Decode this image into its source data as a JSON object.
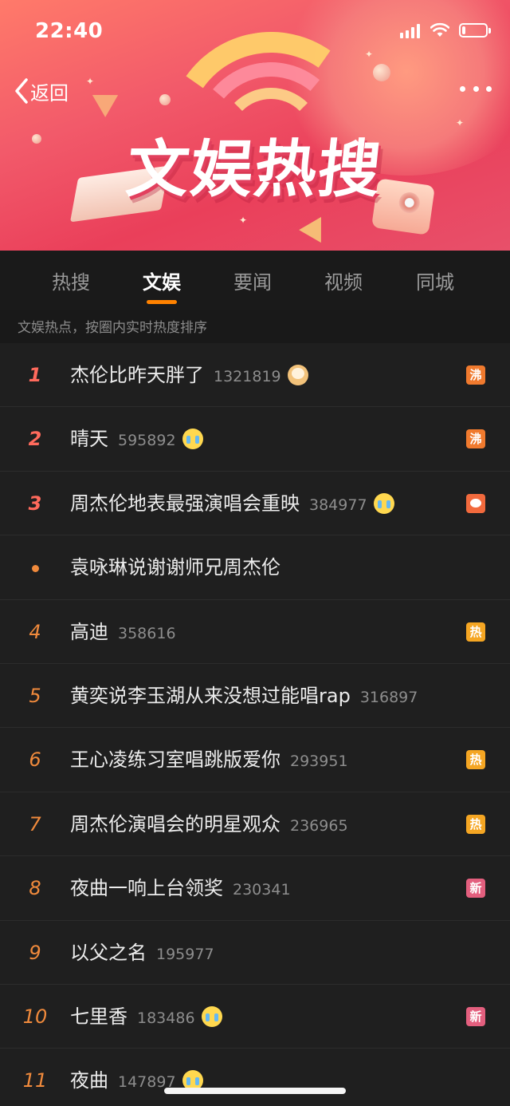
{
  "status_bar": {
    "time": "22:40",
    "battery_level": 0.15
  },
  "header": {
    "back_label": "返回",
    "title": "文娱热搜"
  },
  "tabs": [
    {
      "label": "热搜",
      "active": false
    },
    {
      "label": "文娱",
      "active": true
    },
    {
      "label": "要闻",
      "active": false
    },
    {
      "label": "视频",
      "active": false
    },
    {
      "label": "同城",
      "active": false
    }
  ],
  "subheading": "文娱热点，按圈内实时热度排序",
  "accent_color": "#ff8200",
  "list": [
    {
      "rank": "1",
      "topic": "杰伦比昨天胖了",
      "count": "1321819",
      "emoji": "dog-icon",
      "badge": "沸",
      "badge_type": "boil"
    },
    {
      "rank": "2",
      "topic": "晴天",
      "count": "595892",
      "emoji": "crying-face-icon",
      "badge": "沸",
      "badge_type": "boil"
    },
    {
      "rank": "3",
      "topic": "周杰伦地表最强演唱会重映",
      "count": "384977",
      "emoji": "crying-face-icon",
      "badge": "",
      "badge_type": "talk"
    },
    {
      "rank": "•",
      "topic": "袁咏琳说谢谢师兄周杰伦",
      "count": "",
      "emoji": "",
      "badge": "",
      "badge_type": ""
    },
    {
      "rank": "4",
      "topic": "高迪",
      "count": "358616",
      "emoji": "",
      "badge": "热",
      "badge_type": "hot"
    },
    {
      "rank": "5",
      "topic": "黄奕说李玉湖从来没想过能唱rap",
      "count": "316897",
      "emoji": "",
      "badge": "",
      "badge_type": ""
    },
    {
      "rank": "6",
      "topic": "王心凌练习室唱跳版爱你",
      "count": "293951",
      "emoji": "",
      "badge": "热",
      "badge_type": "hot"
    },
    {
      "rank": "7",
      "topic": "周杰伦演唱会的明星观众",
      "count": "236965",
      "emoji": "",
      "badge": "热",
      "badge_type": "hot"
    },
    {
      "rank": "8",
      "topic": "夜曲一响上台领奖",
      "count": "230341",
      "emoji": "",
      "badge": "新",
      "badge_type": "new"
    },
    {
      "rank": "9",
      "topic": "以父之名",
      "count": "195977",
      "emoji": "",
      "badge": "",
      "badge_type": ""
    },
    {
      "rank": "10",
      "topic": "七里香",
      "count": "183486",
      "emoji": "crying-face-icon",
      "badge": "新",
      "badge_type": "new"
    },
    {
      "rank": "11",
      "topic": "夜曲",
      "count": "147897",
      "emoji": "crying-face-icon",
      "badge": "",
      "badge_type": ""
    }
  ]
}
